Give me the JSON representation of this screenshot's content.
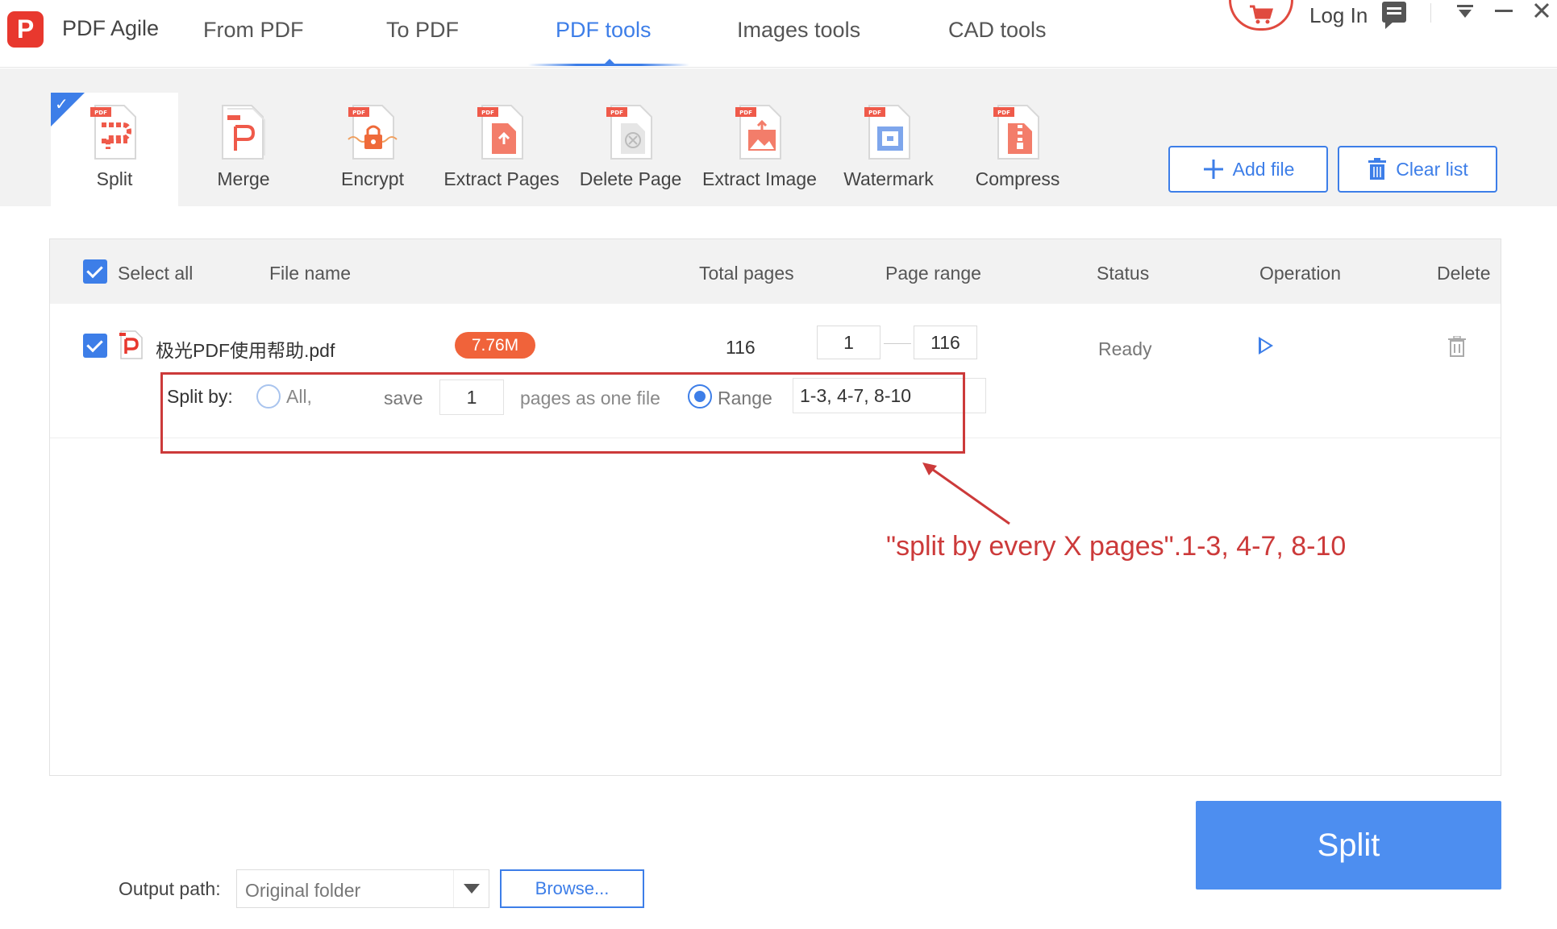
{
  "app": {
    "name": "PDF Agile",
    "logo_letter": "P"
  },
  "nav": {
    "tabs": [
      {
        "label": "From PDF"
      },
      {
        "label": "To PDF"
      },
      {
        "label": "PDF tools",
        "active": true
      },
      {
        "label": "Images tools"
      },
      {
        "label": "CAD tools"
      }
    ],
    "login_label": "Log In"
  },
  "toolbar": {
    "tools": [
      {
        "label": "Split",
        "active": true,
        "icon": "split-icon"
      },
      {
        "label": "Merge",
        "icon": "merge-icon"
      },
      {
        "label": "Encrypt",
        "icon": "lock-icon"
      },
      {
        "label": "Extract Pages",
        "icon": "extract-pages-icon"
      },
      {
        "label": "Delete Page",
        "icon": "delete-page-icon"
      },
      {
        "label": "Extract Image",
        "icon": "extract-image-icon"
      },
      {
        "label": "Watermark",
        "icon": "watermark-icon"
      },
      {
        "label": "Compress",
        "icon": "compress-icon"
      }
    ],
    "badge_text": "PDF",
    "add_file_label": "Add file",
    "clear_list_label": "Clear list"
  },
  "table": {
    "headers": {
      "select_all": "Select all",
      "file_name": "File name",
      "total_pages": "Total pages",
      "page_range": "Page range",
      "status": "Status",
      "operation": "Operation",
      "delete": "Delete"
    },
    "rows": [
      {
        "file_name": "极光PDF使用帮助.pdf",
        "size": "7.76M",
        "total_pages": "116",
        "range_from": "1",
        "range_to": "116",
        "status": "Ready"
      }
    ],
    "split_options": {
      "label": "Split by:",
      "all_label": "All,",
      "save_label": "save",
      "pages_value": "1",
      "pages_suffix": "pages as one file",
      "range_label": "Range",
      "range_value": "1-3, 4-7, 8-10",
      "selected": "Range"
    }
  },
  "annotation": {
    "text": "\"split by every X pages\".1-3, 4-7, 8-10",
    "color": "#cc3a3a"
  },
  "footer": {
    "output_label": "Output path:",
    "output_value": "Original folder",
    "browse_label": "Browse...",
    "split_label": "Split"
  },
  "colors": {
    "accent": "#3d7ee8",
    "brand": "#e8382e",
    "badge": "#f0633a"
  }
}
